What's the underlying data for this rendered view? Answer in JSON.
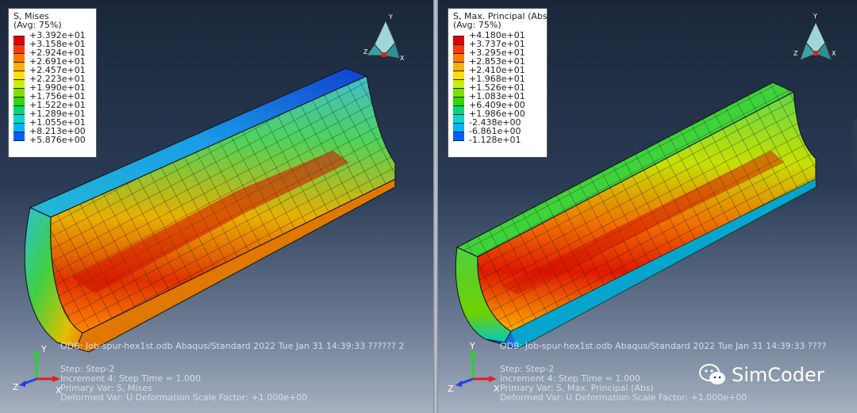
{
  "colors": {
    "bg_top": "#1b2639",
    "bg_bottom": "#a6b0c0",
    "text": "#d7dde6",
    "spectrum": [
      "#e00000",
      "#ff3a00",
      "#ff7a00",
      "#ffb000",
      "#ffe000",
      "#c8ef00",
      "#7ee000",
      "#2cd800",
      "#00d87a",
      "#00d8d0",
      "#00b4ff",
      "#0060ff",
      "#0000d0"
    ]
  },
  "left": {
    "legend": {
      "title_line1": "S, Mises",
      "title_line2": "(Avg: 75%)",
      "values": [
        "+3.392e+01",
        "+3.158e+01",
        "+2.924e+01",
        "+2.691e+01",
        "+2.457e+01",
        "+2.223e+01",
        "+1.990e+01",
        "+1.756e+01",
        "+1.522e+01",
        "+1.289e+01",
        "+1.055e+01",
        "+8.213e+00",
        "+5.876e+00"
      ]
    },
    "triad_labels": {
      "y": "Y",
      "z": "Z",
      "x": "X"
    },
    "info": {
      "odb": "ODB: Job-spur-hex1st.odb    Abaqus/Standard 2022    Tue Jan 31 14:39:33 ?????? 2",
      "step": "Step: Step-2",
      "increment": "Increment     4: Step Time =    1.000",
      "primary": "Primary Var: S, Mises",
      "deformed": "Deformed Var: U   Deformation Scale Factor: +1.000e+00"
    },
    "orientation_labels": {
      "y": "Y",
      "z": "Z",
      "x": "X"
    }
  },
  "right": {
    "legend": {
      "title_line1": "S, Max. Principal (Abs)",
      "title_line2": "(Avg: 75%)",
      "values": [
        "+4.180e+01",
        "+3.737e+01",
        "+3.295e+01",
        "+2.853e+01",
        "+2.410e+01",
        "+1.968e+01",
        "+1.526e+01",
        "+1.083e+01",
        "+6.409e+00",
        "+1.986e+00",
        "-2.438e+00",
        "-6.861e+00",
        "-1.128e+01"
      ]
    },
    "triad_labels": {
      "y": "Y",
      "z": "Z",
      "x": "X"
    },
    "info": {
      "odb": "ODB: Job-spur-hex1st.odb    Abaqus/Standard 2022    Tue Jan 31 14:39:33 ????",
      "step": "Step: Step-2",
      "increment": "Increment     4: Step Time =    1.000",
      "primary": "Primary Var: S, Max. Principal (Abs)",
      "deformed": "Deformed Var: U   Deformation Scale Factor: +1.000e+00"
    },
    "orientation_labels": {
      "y": "Y",
      "z": "Z",
      "x": "X"
    }
  },
  "watermark": {
    "text": "SimCoder",
    "icon": "wechat-icon"
  }
}
